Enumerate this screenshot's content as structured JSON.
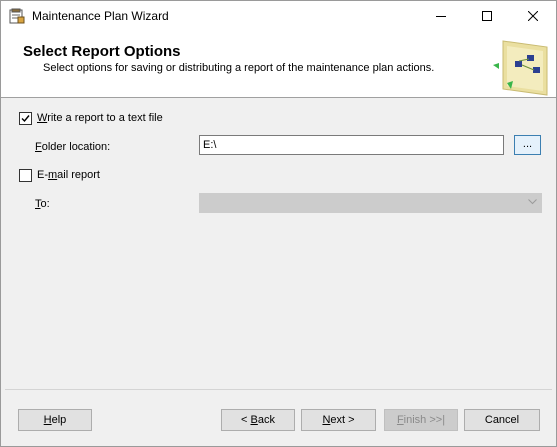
{
  "window": {
    "title": "Maintenance Plan Wizard"
  },
  "header": {
    "title": "Select Report Options",
    "subtitle": "Select options for saving or distributing a report of the maintenance plan actions."
  },
  "text_report": {
    "checkbox_label_underlined": "W",
    "checkbox_label_rest": "rite a report to a text file",
    "checked": true,
    "folder_label_underlined": "F",
    "folder_label_rest": "older location:",
    "folder_value": "E:\\",
    "browse_label": "..."
  },
  "email_report": {
    "checkbox_label_prefix": "E-",
    "checkbox_label_underlined": "m",
    "checkbox_label_rest": "ail report",
    "checked": false,
    "to_label_underlined": "T",
    "to_label_rest": "o:",
    "to_value": ""
  },
  "buttons": {
    "help_underlined": "H",
    "help_rest": "elp",
    "back_prefix": "< ",
    "back_underlined": "B",
    "back_rest": "ack",
    "next_underlined": "N",
    "next_rest": "ext >",
    "finish_underlined": "F",
    "finish_rest": "inish >>|",
    "cancel": "Cancel"
  },
  "colors": {
    "header_bg": "#ffffff",
    "body_bg": "#f0f0f0",
    "browse_border": "#3c7fb1"
  }
}
